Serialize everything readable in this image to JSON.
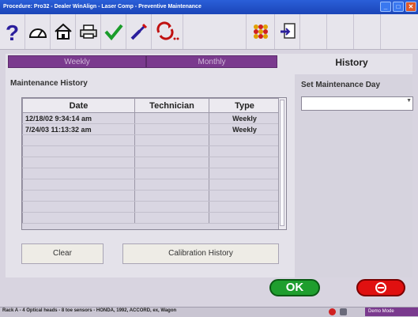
{
  "window": {
    "title": "Procedure: Pro32 - Dealer WinAlign - Laser Comp - Preventive Maintenance",
    "controls": [
      "minimize",
      "maximize",
      "close"
    ]
  },
  "toolbar": {
    "icons": [
      "help-icon",
      "gauge-icon",
      "home-icon",
      "printer-icon",
      "checkmark-icon",
      "wrench-icon",
      "refresh-icon",
      "settings-icon",
      "export-icon"
    ]
  },
  "tabs": {
    "weekly": "Weekly",
    "monthly": "Monthly",
    "history": "History"
  },
  "maintenance_history": {
    "title": "Maintenance History",
    "columns": [
      "Date",
      "Technician",
      "Type"
    ],
    "rows": [
      {
        "date": "12/18/02 9:34:14 am",
        "technician": "",
        "type": "Weekly"
      },
      {
        "date": "7/24/03 11:13:32 am",
        "technician": "",
        "type": "Weekly"
      }
    ]
  },
  "buttons": {
    "clear": "Clear",
    "calibration_history": "Calibration History",
    "ok": "OK"
  },
  "set_maintenance_day": {
    "title": "Set Maintenance Day",
    "value": ""
  },
  "status": {
    "text": "Rack A - 4 Optical heads - 8 toe sensors - HONDA, 1992, ACCORD, ex, Wagon",
    "mode": "Demo Mode"
  },
  "colors": {
    "accent": "#7a3a8e",
    "title_bar": "#1b45b8",
    "ok": "#1f9e2e",
    "cancel": "#e01010"
  }
}
